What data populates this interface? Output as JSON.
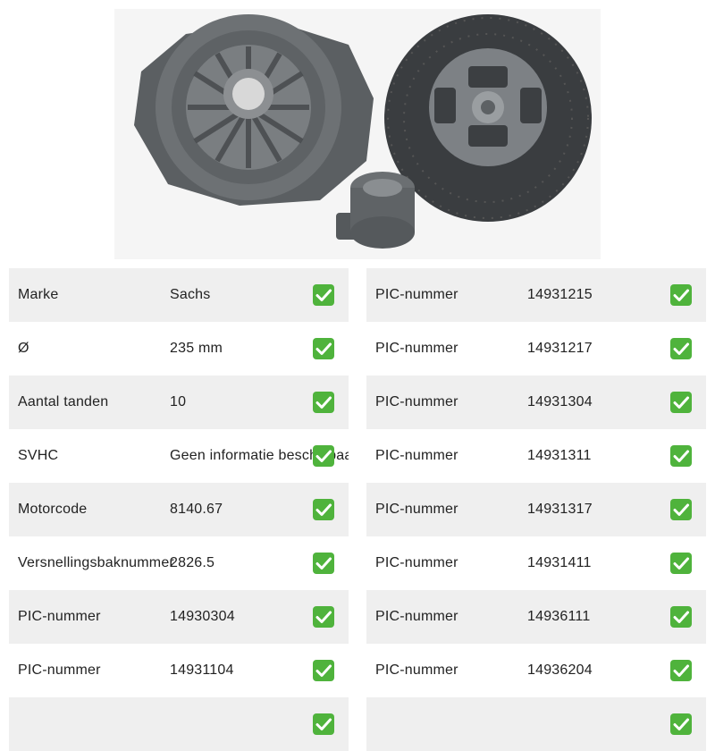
{
  "product": {
    "image_alt": "Sachs koppelingsset",
    "accent_check_color": "#4fb33c"
  },
  "specs_left": [
    {
      "label": "Marke",
      "value": "Sachs",
      "ok_icon": "check-mark-icon"
    },
    {
      "label": "Ø",
      "value": "235 mm",
      "ok_icon": "check-mark-icon"
    },
    {
      "label": "Aantal tanden",
      "value": "10",
      "ok_icon": "check-mark-icon"
    },
    {
      "label": "SVHC",
      "value": "Geen informatie beschikbaar",
      "ok_icon": "check-mark-icon"
    },
    {
      "label": "Motorcode",
      "value": "8140.67",
      "ok_icon": "check-mark-icon"
    },
    {
      "label": "Versnellingsbaknummer",
      "value": "2826.5",
      "ok_icon": "check-mark-icon"
    },
    {
      "label": "PIC-nummer",
      "value": "14930304",
      "ok_icon": "check-mark-icon"
    },
    {
      "label": "PIC-nummer",
      "value": "14931104",
      "ok_icon": "check-mark-icon"
    },
    {
      "label": "",
      "value": "",
      "ok_icon": "check-mark-icon"
    }
  ],
  "specs_right": [
    {
      "label": "PIC-nummer",
      "value": "14931215",
      "ok_icon": "check-mark-icon"
    },
    {
      "label": "PIC-nummer",
      "value": "14931217",
      "ok_icon": "check-mark-icon"
    },
    {
      "label": "PIC-nummer",
      "value": "14931304",
      "ok_icon": "check-mark-icon"
    },
    {
      "label": "PIC-nummer",
      "value": "14931311",
      "ok_icon": "check-mark-icon"
    },
    {
      "label": "PIC-nummer",
      "value": "14931317",
      "ok_icon": "check-mark-icon"
    },
    {
      "label": "PIC-nummer",
      "value": "14931411",
      "ok_icon": "check-mark-icon"
    },
    {
      "label": "PIC-nummer",
      "value": "14936111",
      "ok_icon": "check-mark-icon"
    },
    {
      "label": "PIC-nummer",
      "value": "14936204",
      "ok_icon": "check-mark-icon"
    },
    {
      "label": "",
      "value": "",
      "ok_icon": "check-mark-icon"
    }
  ]
}
